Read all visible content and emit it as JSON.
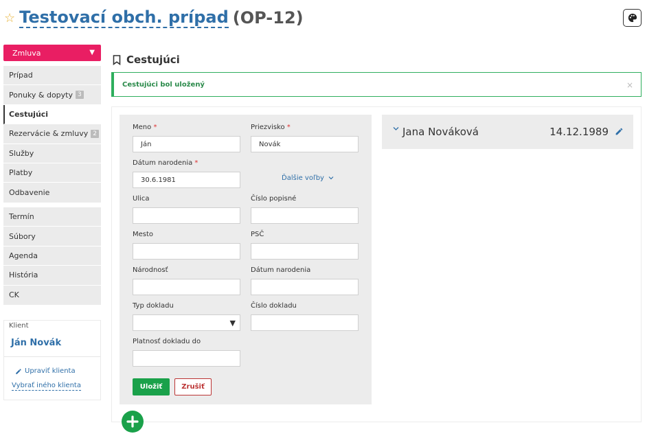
{
  "header": {
    "title": "Testovací obch. prípad",
    "code": "(OP-12)"
  },
  "contract_select": {
    "label": "Zmluva"
  },
  "nav_main": [
    {
      "label": "Prípad"
    },
    {
      "label": "Ponuky & dopyty",
      "badge": "3"
    },
    {
      "label": "Cestujúci",
      "active": true
    },
    {
      "label": "Rezervácie & zmluvy",
      "badge": "2"
    },
    {
      "label": "Služby"
    },
    {
      "label": "Platby"
    },
    {
      "label": "Odbavenie"
    }
  ],
  "nav_secondary": [
    {
      "label": "Termín"
    },
    {
      "label": "Súbory"
    },
    {
      "label": "Agenda"
    },
    {
      "label": "História"
    },
    {
      "label": "CK"
    }
  ],
  "client": {
    "label": "Klient",
    "name": "Ján Novák",
    "edit_label": "Upraviť klienta",
    "select_label": "Vybrať iného klienta"
  },
  "section": {
    "title": "Cestujúci"
  },
  "alert": {
    "message": "Cestujúci bol uložený",
    "close": "×"
  },
  "form": {
    "first_name": {
      "label": "Meno",
      "value": "Ján"
    },
    "last_name": {
      "label": "Priezvisko",
      "value": "Novák"
    },
    "birth_date": {
      "label": "Dátum narodenia",
      "value": "30.6.1981"
    },
    "more_options": "Ďalšie voľby",
    "street": {
      "label": "Ulica",
      "value": ""
    },
    "house_number": {
      "label": "Číslo popisné",
      "value": ""
    },
    "city": {
      "label": "Mesto",
      "value": ""
    },
    "zip": {
      "label": "PSČ",
      "value": ""
    },
    "nationality": {
      "label": "Národnosť",
      "value": ""
    },
    "birth_date_2": {
      "label": "Dátum narodenia",
      "value": ""
    },
    "doc_type": {
      "label": "Typ dokladu",
      "value": ""
    },
    "doc_number": {
      "label": "Číslo dokladu",
      "value": ""
    },
    "doc_valid": {
      "label": "Platnosť dokladu do",
      "value": ""
    },
    "save_label": "Uložiť",
    "cancel_label": "Zrušiť"
  },
  "traveler": {
    "name": "Jana Nováková",
    "birth_date": "14.12.1989"
  },
  "colors": {
    "brand_blue": "#2f6fa8",
    "contract_pink": "#e91e63",
    "success_green": "#1aa14a",
    "danger_red": "#bb3333"
  }
}
